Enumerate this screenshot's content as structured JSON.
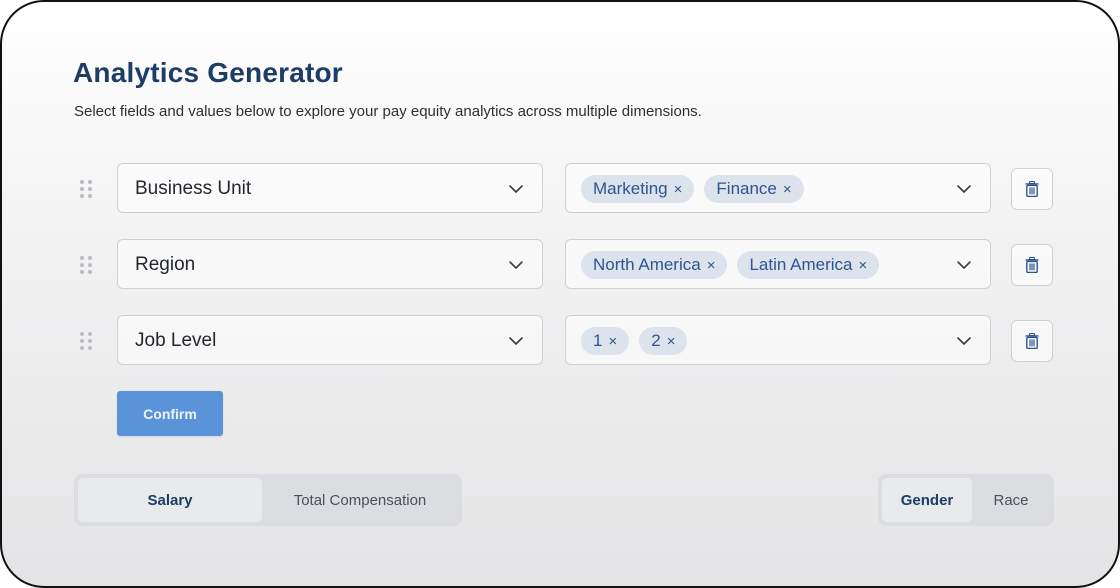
{
  "header": {
    "title": "Analytics Generator",
    "subtitle": "Select fields and values below to explore your pay equity analytics across multiple dimensions."
  },
  "rows": [
    {
      "field": "Business Unit",
      "values": [
        "Marketing",
        "Finance"
      ]
    },
    {
      "field": "Region",
      "values": [
        "North America",
        "Latin America"
      ]
    },
    {
      "field": "Job Level",
      "values": [
        "1",
        "2"
      ]
    }
  ],
  "chip_remove_glyph": "×",
  "confirm_label": "Confirm",
  "metric_toggle": {
    "options": [
      "Salary",
      "Total Compensation"
    ],
    "selected": "Salary"
  },
  "dimension_toggle": {
    "options": [
      "Gender",
      "Race"
    ],
    "selected": "Gender"
  },
  "icons": {
    "drag": "drag-handle-icon",
    "chevron": "chevron-down-icon",
    "delete": "trash-icon"
  },
  "colors": {
    "title": "#1d3c66",
    "chip_bg": "#dde3ec",
    "chip_text": "#2d5590",
    "confirm_bg": "#5b93d9"
  }
}
